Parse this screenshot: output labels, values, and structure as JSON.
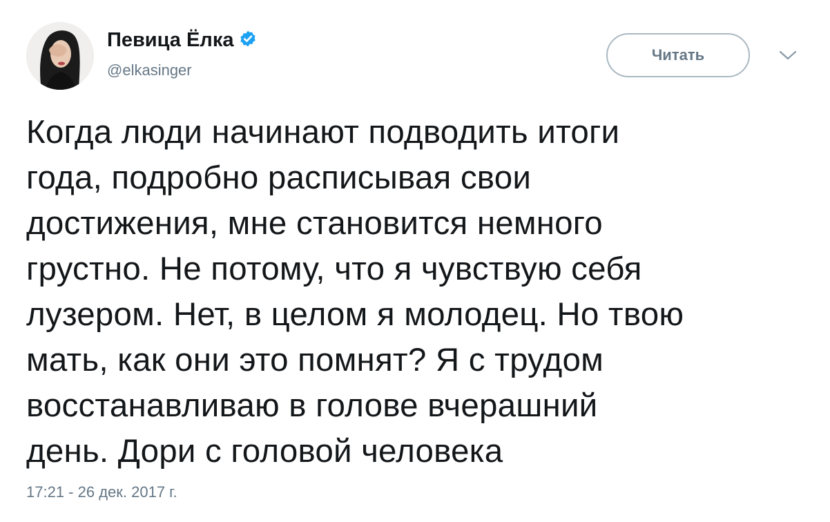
{
  "author": {
    "display_name": "Певица Ёлка",
    "handle": "@elkasinger",
    "verified": true,
    "avatar_icon": "avatar-photo"
  },
  "actions": {
    "follow_label": "Читать",
    "menu_icon": "chevron-down-icon"
  },
  "tweet": {
    "lines": [
      "Когда люди начинают подводить итоги",
      "года, подробно расписывая свои",
      "достижения, мне становится немного",
      "грустно. Не потому, что я чувствую себя",
      "лузером. Нет, в целом я молодец. Но твою",
      "мать, как они это помнят? Я с трудом",
      "восстанавливаю в голове вчерашний",
      "день. Дори с головой человека"
    ],
    "timestamp": "17:21 - 26 дек. 2017 г."
  },
  "colors": {
    "text": "#14171a",
    "secondary": "#657786",
    "verified": "#1da1f2",
    "button_border": "#aab8c2"
  }
}
